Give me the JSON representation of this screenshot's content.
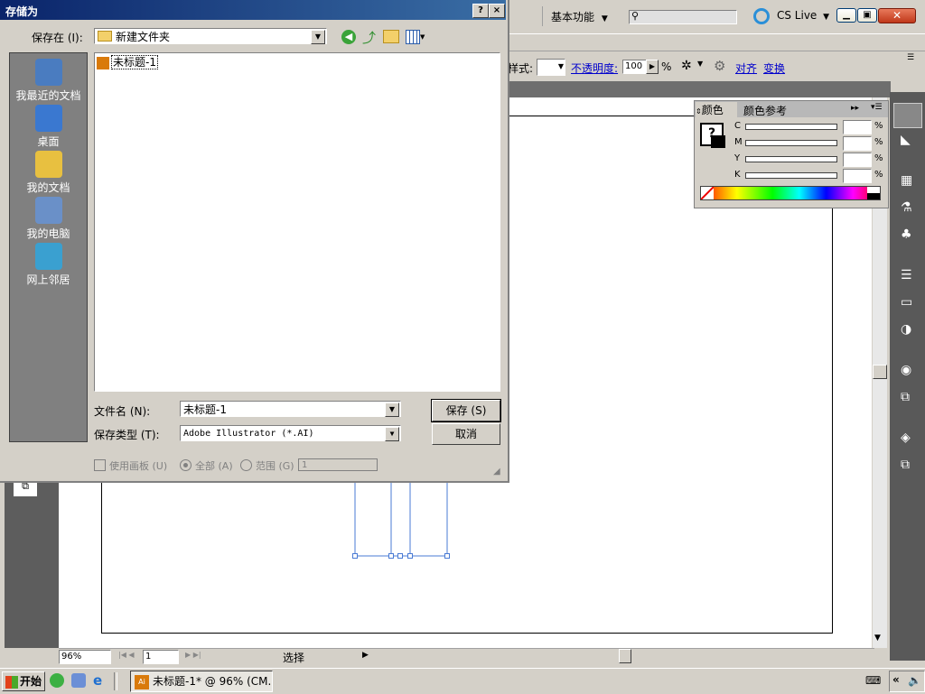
{
  "dialog": {
    "title": "存储为",
    "help": "?",
    "close": "×",
    "save_in_label": "保存在 (I):",
    "save_in_value": "新建文件夹",
    "places": [
      {
        "label": "我最近的文档",
        "icon": "recent-docs-icon"
      },
      {
        "label": "桌面",
        "icon": "desktop-icon"
      },
      {
        "label": "我的文档",
        "icon": "my-documents-icon"
      },
      {
        "label": "我的电脑",
        "icon": "my-computer-icon"
      },
      {
        "label": "网上邻居",
        "icon": "network-icon"
      }
    ],
    "files": [
      {
        "name": "未标题-1",
        "icon": "ai-file-icon"
      }
    ],
    "filename_label": "文件名 (N):",
    "filename_value": "未标题-1",
    "filetype_label": "保存类型 (T):",
    "filetype_value": "Adobe Illustrator (*.AI)",
    "save_button": "保存 (S)",
    "cancel_button": "取消",
    "use_artboards": "使用画板 (U)",
    "all": "全部 (A)",
    "range": "范围 (G)",
    "range_value": "1"
  },
  "illustrator": {
    "workspace": "基本功能",
    "cs_live": "CS Live",
    "style_label": "样式:",
    "opacity_label": "不透明度:",
    "opacity_value": "100",
    "percent": "%",
    "align": "对齐",
    "transform": "变换",
    "color_panel": {
      "tab_color": "颜色",
      "tab_guide": "颜色参考",
      "channels": [
        "C",
        "M",
        "Y",
        "K"
      ],
      "unit": "%"
    },
    "zoom": "96%",
    "artboard_number": "1",
    "status_label": "选择"
  },
  "taskbar": {
    "start": "开始",
    "task": "未标题-1* @ 96% (CM..."
  },
  "colors": {
    "title_start": "#0a246a",
    "title_end": "#3a6ea5",
    "dialog_bg": "#d4d0c8",
    "link_blue": "#0000cc",
    "path_blue": "#4a7bd4"
  }
}
